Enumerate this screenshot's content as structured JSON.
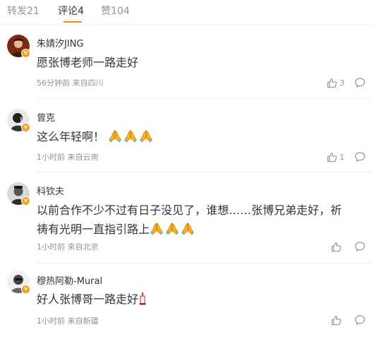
{
  "tabs": [
    {
      "label": "转发21",
      "active": false
    },
    {
      "label": "评论4",
      "active": true
    },
    {
      "label": "赞104",
      "active": false
    }
  ],
  "accent_color": "#ff8200",
  "badge_color": "#f4a21d",
  "comments": [
    {
      "username": "朱婧汐JING",
      "text": "愿张博老师一路走好",
      "meta": "56分钟前 来自四川",
      "likes": "3",
      "emoji": []
    },
    {
      "username": "曾克",
      "text": "这么年轻啊！",
      "meta": "1小时前 来自云南",
      "likes": "1",
      "emoji": [
        "pray-icon",
        "pray-icon",
        "pray-icon"
      ]
    },
    {
      "username": "科钦夫",
      "text": "以前合作不少不过有日子没见了，谁想……张博兄弟走好，祈祷有光明一直指引路上",
      "meta": "1小时前 来自北京",
      "likes": "",
      "emoji": [
        "pray-icon",
        "pray-icon",
        "pray-icon"
      ]
    },
    {
      "username": "穆热阿勒-Mural",
      "text": "好人张博哥一路走好",
      "meta": "1小时前 来自新疆",
      "likes": "",
      "emoji": [
        "candle-icon"
      ]
    }
  ]
}
